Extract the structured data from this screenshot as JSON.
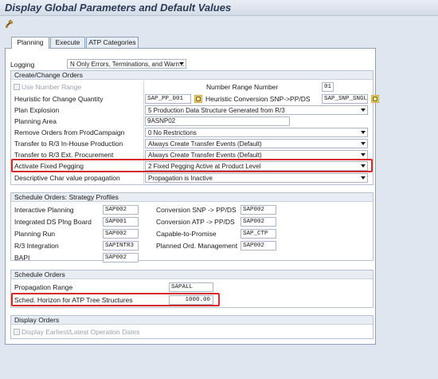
{
  "window": {
    "title": "Display Global Parameters and Default Values"
  },
  "toolbar": {
    "icon": "tool-wrench-icon"
  },
  "tabs": [
    {
      "label": "Planning",
      "active": true
    },
    {
      "label": "Execute",
      "active": false
    },
    {
      "label": "ATP Categories",
      "active": false
    }
  ],
  "logging": {
    "label": "Logging",
    "value": "N Only Errors, Terminations, and Warn..."
  },
  "create_change": {
    "header": "Create/Change Orders",
    "use_number_range": "Use Number Range",
    "number_range_number_label": "Number Range Number",
    "number_range_number": "01",
    "heuristic_change_qty_label": "Heuristic for Change Quantity",
    "heuristic_change_qty": "SAP_PP_001",
    "heuristic_conv_label": "Heuristic Conversion SNP->PP/DS",
    "heuristic_conv": "SAP_SNP_SNGL",
    "plan_explosion_label": "Plan Explosion",
    "plan_explosion": "5 Production Data Structure Generated from R/3",
    "planning_area_label": "Planning Area",
    "planning_area": "9ASNP02",
    "remove_orders_label": "Remove Orders from ProdCampaign",
    "remove_orders": "0 No Restrictions",
    "transfer_inhouse_label": "Transfer to R/3 In-House Production",
    "transfer_inhouse": "Always Create Transfer Events (Default)",
    "transfer_ext_label": "Transfer to R/3 Ext. Procurement",
    "transfer_ext": "Always Create Transfer Events (Default)",
    "fixed_pegging_label": "Activate Fixed Pegging",
    "fixed_pegging": "2 Fixed Pegging Active at Product Level",
    "desc_char_label": "Descriptive Char value propagation",
    "desc_char": "Propagation is Inactive"
  },
  "strategy": {
    "header": "Schedule Orders: Strategy Profiles",
    "left": [
      {
        "label": "Interactive Planning",
        "value": "SAP002"
      },
      {
        "label": "Integrated DS Plng Board",
        "value": "SAP001"
      },
      {
        "label": "Planning Run",
        "value": "SAP002"
      },
      {
        "label": "R/3 Integration",
        "value": "SAPINTR3"
      },
      {
        "label": "BAPI",
        "value": "SAP002"
      }
    ],
    "right": [
      {
        "label": "Conversion SNP -> PP/DS",
        "value": "SAP002"
      },
      {
        "label": "Conversion ATP -> PP/DS",
        "value": "SAP002"
      },
      {
        "label": "Capable-to-Promise",
        "value": "SAP_CTP"
      },
      {
        "label": "Planned Ord. Management",
        "value": "SAP002"
      }
    ]
  },
  "schedule": {
    "header": "Schedule Orders",
    "propagation_label": "Propagation Range",
    "propagation": "SAPALL",
    "sched_horizon_label": "Sched. Horizon for ATP Tree Structures",
    "sched_horizon": "1000.00"
  },
  "display": {
    "header": "Display Orders",
    "earliest_latest": "Display Earliest/Latest Operation Dates"
  },
  "colors": {
    "highlight": "#d62b2b",
    "background": "#dfe6ef"
  }
}
